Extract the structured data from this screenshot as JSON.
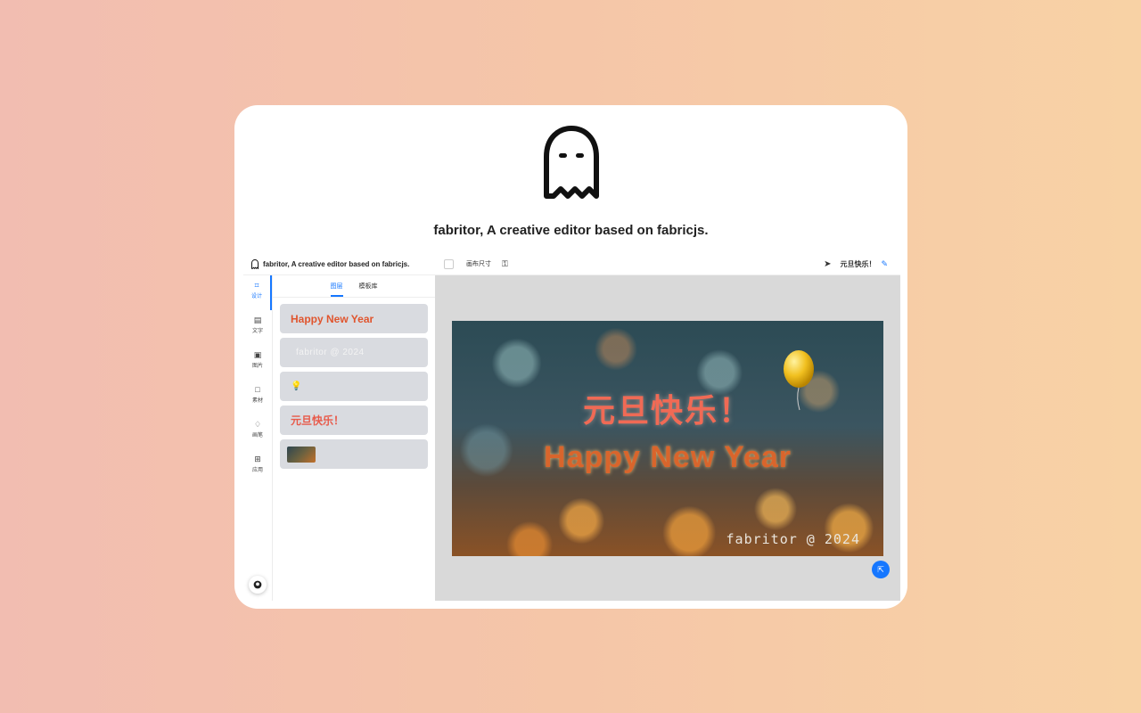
{
  "hero": {
    "title": "fabritor, A creative editor based on fabricjs.",
    "logo_icon": "ghost-icon"
  },
  "app": {
    "header_title": "fabritor, A creative editor based on fabricjs.",
    "toolbar": {
      "size_label": "画布尺寸",
      "layer_name": "元旦快乐！",
      "pointer_icon": "cursor-icon",
      "edit_icon": "pencil-icon"
    },
    "nav": [
      {
        "label": "设计",
        "icon": "design-icon"
      },
      {
        "label": "文字",
        "icon": "text-icon"
      },
      {
        "label": "图片",
        "icon": "image-icon"
      },
      {
        "label": "素材",
        "icon": "shape-icon"
      },
      {
        "label": "画笔",
        "icon": "brush-icon"
      },
      {
        "label": "应用",
        "icon": "apps-icon"
      }
    ],
    "tabs": [
      "图层",
      "模板库"
    ],
    "layers": {
      "hny": "Happy New Year",
      "fab": "fabritor @ 2024",
      "balloon": "💡",
      "cn": "元旦快乐！"
    },
    "canvas": {
      "cn_title": "元旦快乐！",
      "en_title": "Happy New Year",
      "watermark": "fabritor @ 2024"
    }
  },
  "colors": {
    "accent": "#1677ff",
    "bg_left": "#f2bdb1",
    "bg_right": "#f8d2a5"
  }
}
